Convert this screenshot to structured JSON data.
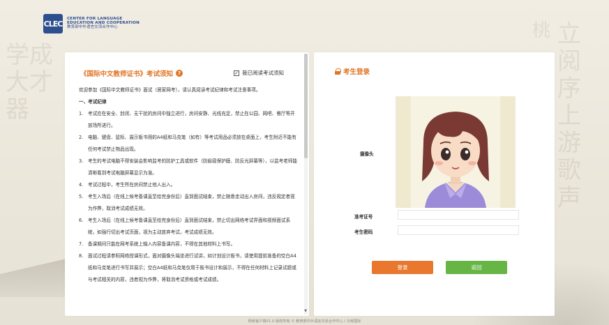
{
  "header": {
    "logo_mark": "CLEC",
    "org_en_line1": "CENTER FOR LANGUAGE",
    "org_en_line2": "EDUCATION AND COOPERATION",
    "org_cn": "教育部中外语言交流合作中心"
  },
  "background": {
    "left_chars": "学成大才器",
    "right_chars": "立阅序上游歌声",
    "right_chars2": "桃"
  },
  "notice": {
    "title": "《国际中文教师证书》考试须知",
    "read_checkbox_label": "我已阅读考试须知",
    "read_checked": true,
    "intro": "欢迎参加《国际中文教师证书》面试（居家网考），请认真阅读考试纪律和考试注意事项。",
    "section1": "一、考试纪律",
    "items": [
      {
        "num": "1.",
        "text": "考试应在安全、封闭、无干扰的房间中独立进行，房间安静、光线充足，禁止在公园、网吧、餐厅等开放场所进行。"
      },
      {
        "num": "2.",
        "text": "电脑、键盘、鼠标、展示板书用的A4纸和马克笔（如有）等考试用品必须放在桌面上，考生附近不能有任何考试禁止物品出现。"
      },
      {
        "num": "3.",
        "text": "考生的考试电脑不得安装会影响监考的防护工具或软件（防偷窥保护膜、防反光屏幕等），以监考老师能清晰看到考试电脑屏幕显示为准。"
      },
      {
        "num": "4.",
        "text": "考试过程中，考生所在房间禁止他人出入。"
      },
      {
        "num": "5.",
        "text": "考生入场后（在线上候考备课直至给完身份后）直到面试结束，禁止随意走动出入房间，违反规定者视为作弊，取消考试成绩无效。"
      },
      {
        "num": "6.",
        "text": "考生入场后（在线上候考备课直至给完身份后）直到面试结束，禁止切出网络考试界面和视频面试系统，如强行切出考试页面，视为主动放弃考试，考试成绩无效。"
      },
      {
        "num": "7.",
        "text": "备课期间只能在网考系统上输入内容备课内容，不得在其他材料上书写。"
      },
      {
        "num": "8.",
        "text": "面试过程请参照网络授课形式，面对摄像头端坐进行试讲，如计划设计板书，请使用提前准备的空白A4纸和马克笔进行书写并展示；空白A4纸和马克笔仅用于板书设计和展示，不得在任何材料上记录试题或与考试相关的内容，违者视为作弊，将取消考试资格或考试成绩。"
      }
    ]
  },
  "login": {
    "title": "考生登录",
    "camera_label": "摄像头",
    "ticket_label": "准考证号",
    "ticket_value": "",
    "password_label": "考生密码",
    "password_value": "",
    "login_button": "登录",
    "back_button": "返回"
  },
  "footer": {
    "text": "网考客户端V1.0 版权所有 © 教育部中外语言交流合作中心 / 汉考国际"
  },
  "colors": {
    "accent_orange": "#e9782e",
    "accent_green": "#67b544",
    "brand_blue": "#2d4f8d"
  }
}
